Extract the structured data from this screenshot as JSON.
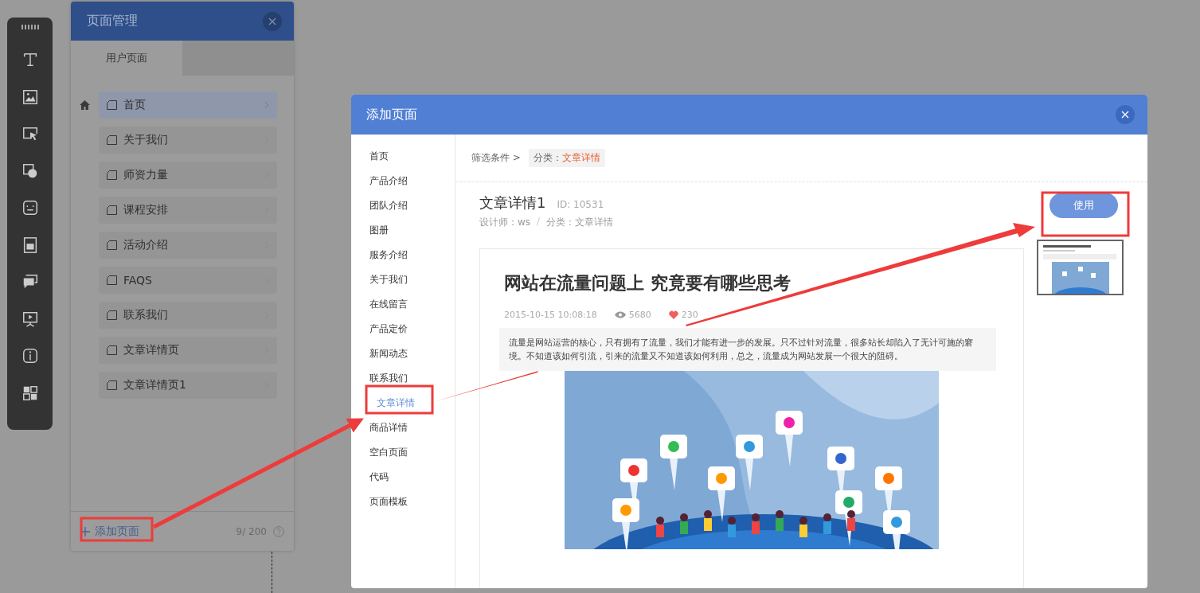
{
  "page_manager": {
    "title": "页面管理",
    "tabs": [
      {
        "label": "用户页面",
        "selected": true
      }
    ],
    "pages": [
      {
        "label": "首页",
        "home": true,
        "selected": true
      },
      {
        "label": "关于我们",
        "home": false,
        "selected": false
      },
      {
        "label": "师资力量",
        "home": false,
        "selected": false
      },
      {
        "label": "课程安排",
        "home": false,
        "selected": false
      },
      {
        "label": "活动介绍",
        "home": false,
        "selected": false
      },
      {
        "label": "FAQS",
        "home": false,
        "selected": false
      },
      {
        "label": "联系我们",
        "home": false,
        "selected": false
      },
      {
        "label": "文章详情页",
        "home": false,
        "selected": false
      },
      {
        "label": "文章详情页1",
        "home": false,
        "selected": false
      }
    ],
    "add_label": "添加页面",
    "count": "9/ 200"
  },
  "dialog": {
    "title": "添加页面",
    "categories": [
      {
        "label": "首页",
        "selected": false
      },
      {
        "label": "产品介绍",
        "selected": false
      },
      {
        "label": "团队介绍",
        "selected": false
      },
      {
        "label": "图册",
        "selected": false
      },
      {
        "label": "服务介绍",
        "selected": false
      },
      {
        "label": "关于我们",
        "selected": false
      },
      {
        "label": "在线留言",
        "selected": false
      },
      {
        "label": "产品定价",
        "selected": false
      },
      {
        "label": "新闻动态",
        "selected": false
      },
      {
        "label": "联系我们",
        "selected": false
      },
      {
        "label": "文章详情",
        "selected": true
      },
      {
        "label": "商品详情",
        "selected": false
      },
      {
        "label": "空白页面",
        "selected": false
      },
      {
        "label": "代码",
        "selected": false
      },
      {
        "label": "页面模板",
        "selected": false
      }
    ],
    "filter": {
      "label": "筛选条件 >",
      "tag_key": "分类：",
      "tag_value": "文章详情"
    },
    "template": {
      "name": "文章详情1",
      "id": "ID: 10531",
      "designer": "设计师：ws",
      "separator": "/",
      "category": "分类：文章详情",
      "use_button": "使用"
    },
    "preview": {
      "title": "网站在流量问题上 究竟要有哪些思考",
      "date": "2015-10-15 10:08:18",
      "views": "5680",
      "likes": "230",
      "summary": "流量是网站运营的核心，只有拥有了流量，我们才能有进一步的发展。只不过针对流量，很多站长却陷入了无计可施的窘境。不知道该如何引流，引来的流量又不知道该如何利用，总之，流量成为网站发展一个很大的阻碍。"
    }
  }
}
